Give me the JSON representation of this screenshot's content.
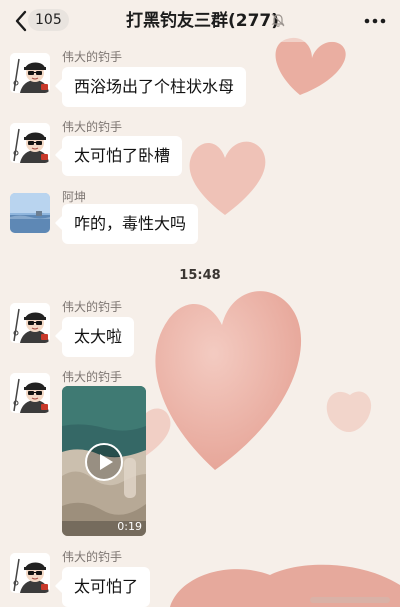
{
  "header": {
    "unread_count": "105",
    "title": "打黑钓友三群(277)"
  },
  "messages": [
    {
      "sender": "伟大的钓手",
      "text": "西浴场出了个柱状水母"
    },
    {
      "sender": "伟大的钓手",
      "text": "太可怕了卧槽"
    },
    {
      "sender": "阿坤",
      "text": "咋的，毒性大吗"
    },
    {
      "sender": "伟大的钓手",
      "text": "太大啦"
    },
    {
      "sender": "伟大的钓手",
      "video_duration": "0:19"
    },
    {
      "sender": "伟大的钓手",
      "text": "太可怕了"
    }
  ],
  "timestamp": "15:48",
  "colors": {
    "background": "#f6efe9",
    "wallpaper_heart": "#e8a396",
    "bubble": "#ffffff"
  },
  "icons": [
    "back-arrow-icon",
    "mute-bell-icon",
    "more-options-icon",
    "play-icon"
  ]
}
